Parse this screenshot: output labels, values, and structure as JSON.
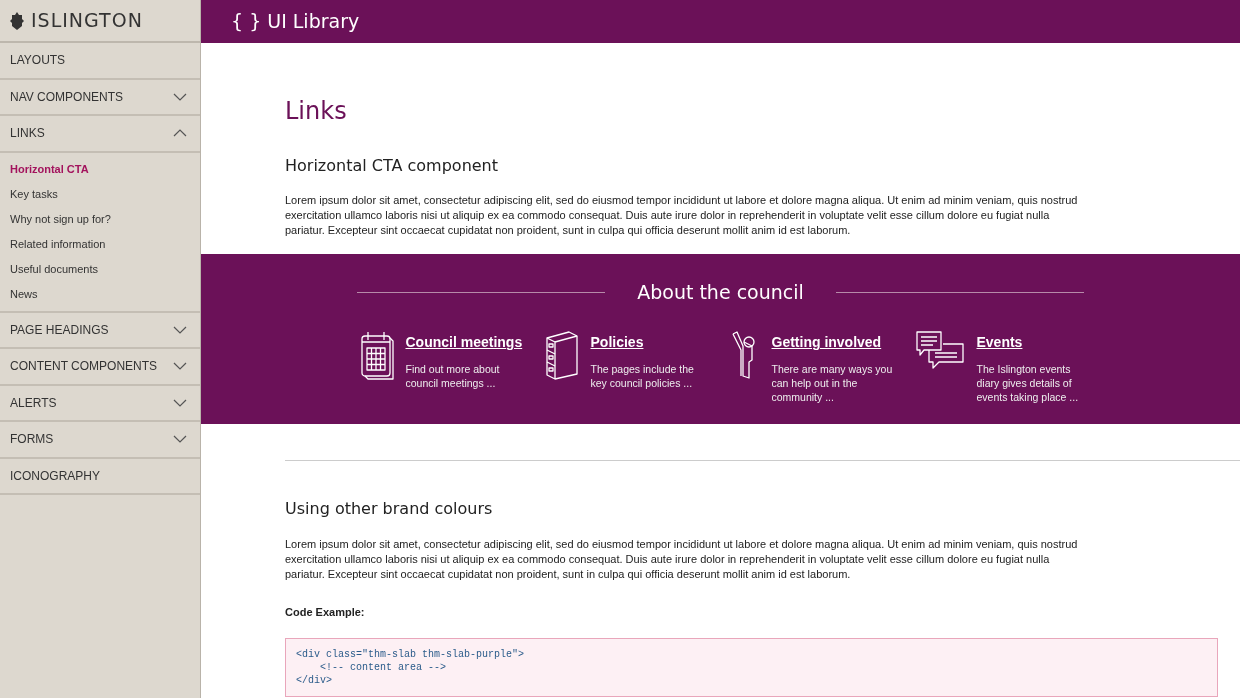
{
  "sidebar": {
    "logo": "ISLINGTON",
    "items": [
      {
        "label": "LAYOUTS",
        "kind": "link"
      },
      {
        "label": "NAV COMPONENTS",
        "kind": "group",
        "expanded": false
      },
      {
        "label": "LINKS",
        "kind": "group",
        "expanded": true,
        "children": [
          {
            "label": "Horizontal CTA",
            "selected": true
          },
          {
            "label": "Key tasks",
            "selected": false
          },
          {
            "label": "Why not sign up for?",
            "selected": false
          },
          {
            "label": "Related information",
            "selected": false
          },
          {
            "label": "Useful documents",
            "selected": false
          },
          {
            "label": "News",
            "selected": false
          }
        ]
      },
      {
        "label": "PAGE HEADINGS",
        "kind": "group",
        "expanded": false
      },
      {
        "label": "CONTENT COMPONENTS",
        "kind": "group",
        "expanded": false
      },
      {
        "label": "ALERTS",
        "kind": "group",
        "expanded": false
      },
      {
        "label": "FORMS",
        "kind": "group",
        "expanded": false
      },
      {
        "label": "ICONOGRAPHY",
        "kind": "link"
      }
    ]
  },
  "header": {
    "brace": "{ }",
    "title": "UI Library"
  },
  "page_title": "Links",
  "section_1": {
    "heading": "Horizontal CTA component",
    "paragraph": "Lorem ipsum dolor sit amet, consectetur adipiscing elit, sed do eiusmod tempor incididunt ut labore et dolore magna aliqua. Ut enim ad minim veniam, quis nostrud exercitation ullamco laboris nisi ut aliquip ex ea commodo consequat. Duis aute irure dolor in reprehenderit in voluptate velit esse cillum dolore eu fugiat nulla pariatur. Excepteur sint occaecat cupidatat non proident, sunt in culpa qui officia deserunt mollit anim id est laborum."
  },
  "cta": {
    "title": "About the council",
    "items": [
      {
        "kind": "calendar",
        "title": "Council meetings",
        "text": "Find out more about council meetings ..."
      },
      {
        "kind": "cabinet",
        "title": "Policies",
        "text": "The pages include the key council policies ..."
      },
      {
        "kind": "person",
        "title": "Getting involved",
        "text": "There are many ways you can help out in the community ..."
      },
      {
        "kind": "chat",
        "title": "Events",
        "text": "The Islington events diary gives details of events taking place ..."
      }
    ]
  },
  "section_2": {
    "heading": "Using other brand colours",
    "paragraph": "Lorem ipsum dolor sit amet, consectetur adipiscing elit, sed do eiusmod tempor incididunt ut labore et dolore magna aliqua. Ut enim ad minim veniam, quis nostrud exercitation ullamco laboris nisi ut aliquip ex ea commodo consequat. Duis aute irure dolor in reprehenderit in voluptate velit esse cillum dolore eu fugiat nulla pariatur. Excepteur sint occaecat cupidatat non proident, sunt in culpa qui officia deserunt mollit anim id est laborum.",
    "code_label": "Code Example:",
    "code_lines": [
      "<div class=\"thm-slab thm-slab-purple\">",
      "    <!-- content area -->",
      "</div>"
    ]
  }
}
